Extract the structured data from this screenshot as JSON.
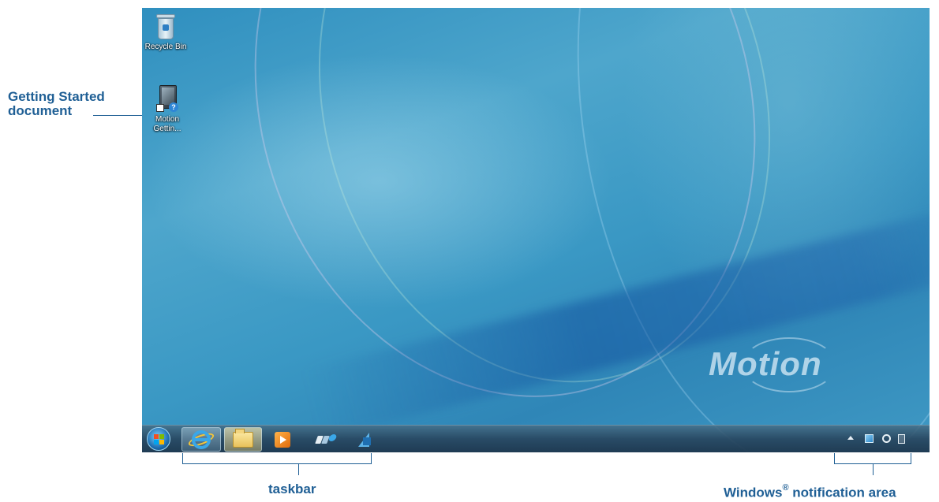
{
  "callouts": {
    "getting_started_line1": "Getting Started",
    "getting_started_line2": "document",
    "taskbar_label": "taskbar",
    "notification_label_prefix": "Windows",
    "notification_label_sup": "®",
    "notification_label_suffix": " notification area"
  },
  "desktop": {
    "icons": [
      {
        "label": "Recycle Bin",
        "icon": "recycle-bin-icon"
      },
      {
        "label_line1": "Motion",
        "label_line2": "Gettin...",
        "icon": "getting-started-document-icon"
      }
    ],
    "wallpaper_brand": "Motion"
  },
  "taskbar": {
    "start_icon": "windows-start-orb-icon",
    "pinned": [
      {
        "name": "internet-explorer",
        "icon": "internet-explorer-icon"
      },
      {
        "name": "windows-explorer",
        "icon": "folder-icon"
      },
      {
        "name": "windows-media-player",
        "icon": "media-player-icon"
      },
      {
        "name": "motion-dashboard",
        "icon": "motion-dashboard-icon"
      },
      {
        "name": "app",
        "icon": "app-icon"
      }
    ],
    "tray": [
      {
        "name": "show-hidden-icons",
        "icon": "chevron-up-icon"
      },
      {
        "name": "action-center",
        "icon": "flag-icon"
      },
      {
        "name": "sync",
        "icon": "sync-icon"
      },
      {
        "name": "power",
        "icon": "power-icon"
      }
    ]
  },
  "colors": {
    "callout": "#1f5f95",
    "desktop_blue": "#3a98c4",
    "taskbar": "#28465f"
  }
}
